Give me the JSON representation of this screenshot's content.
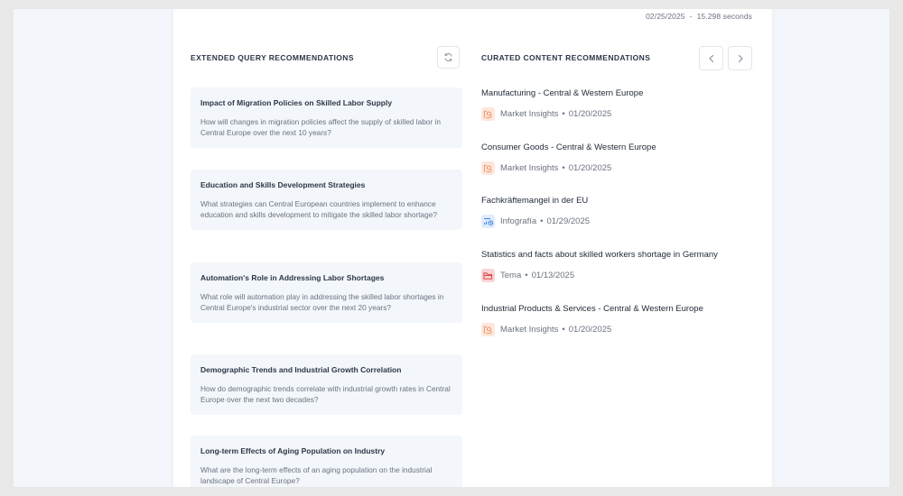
{
  "header": {
    "date": "02/25/2025",
    "separator": "-",
    "duration": "15.298 seconds"
  },
  "extended_queries": {
    "title": "EXTENDED QUERY RECOMMENDATIONS",
    "refresh_icon": "refresh-icon",
    "items": [
      {
        "title": "Impact of Migration Policies on Skilled Labor Supply",
        "description": "How will changes in migration policies affect the supply of skilled labor in Central Europe over the next 10 years?"
      },
      {
        "title": "Education and Skills Development Strategies",
        "description": "What strategies can Central European countries implement to enhance education and skills development to mitigate the skilled labor shortage?"
      },
      {
        "title": "Automation's Role in Addressing Labor Shortages",
        "description": "What role will automation play in addressing the skilled labor shortages in Central Europe's industrial sector over the next 20 years?"
      },
      {
        "title": "Demographic Trends and Industrial Growth Correlation",
        "description": "How do demographic trends correlate with industrial growth rates in Central Europe over the next two decades?"
      },
      {
        "title": "Long-term Effects of Aging Population on Industry",
        "description": "What are the long-term effects of an aging population on the industrial landscape of Central Europe?"
      }
    ]
  },
  "curated_content": {
    "title": "CURATED CONTENT RECOMMENDATIONS",
    "prev_icon": "chevron-left-icon",
    "next_icon": "chevron-right-icon",
    "items": [
      {
        "title": "Manufacturing - Central & Western Europe",
        "type": "Market Insights",
        "icon": "market-insights-icon",
        "date": "01/20/2025"
      },
      {
        "title": "Consumer Goods - Central & Western Europe",
        "type": "Market Insights",
        "icon": "market-insights-icon",
        "date": "01/20/2025"
      },
      {
        "title": "Fachkräftemangel in der EU",
        "type": "Infografía",
        "icon": "infographic-icon",
        "date": "01/29/2025"
      },
      {
        "title": "Statistics and facts about skilled workers shortage in Germany",
        "type": "Tema",
        "icon": "folder-icon",
        "date": "01/13/2025"
      },
      {
        "title": "Industrial Products & Services - Central & Western Europe",
        "type": "Market Insights",
        "icon": "market-insights-icon",
        "date": "01/20/2025"
      }
    ],
    "colors": {
      "market_insights": "#f08a5d",
      "infographic": "#3b82f6",
      "topic": "#d9363e"
    }
  }
}
